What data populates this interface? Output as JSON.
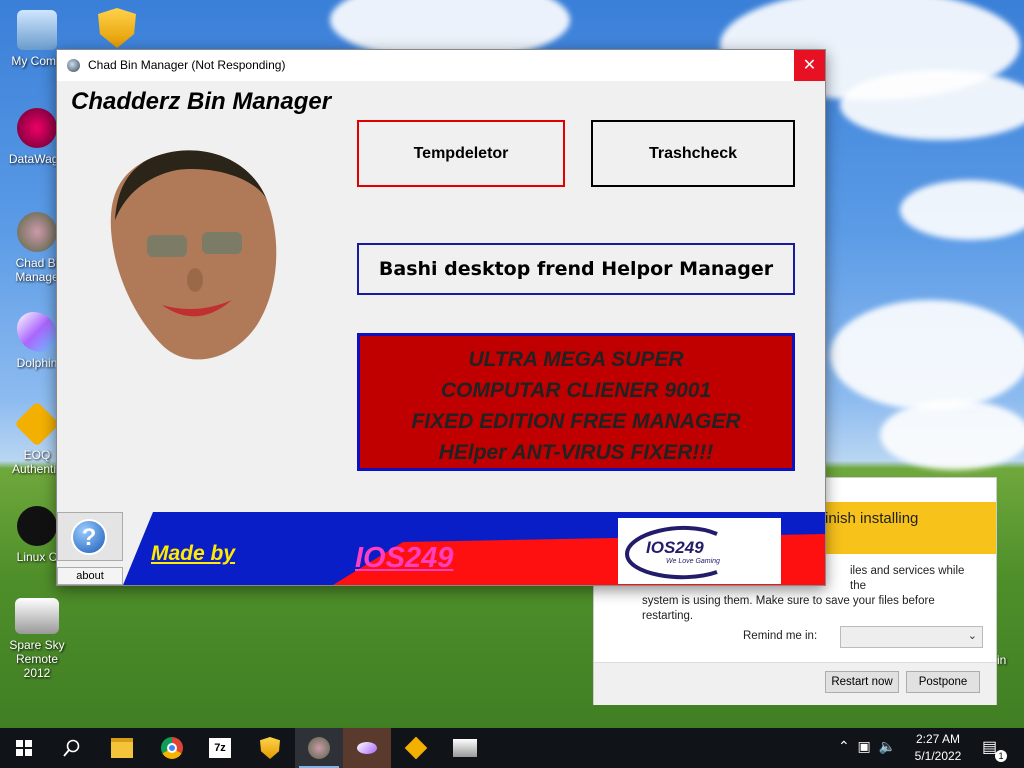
{
  "desktop": {
    "icons": [
      {
        "label": "My Comp"
      },
      {
        "label": "DataWago"
      },
      {
        "label": "Chad Bi\nManage"
      },
      {
        "label": "Dolphin"
      },
      {
        "label": "EOQ\nAuthentic"
      },
      {
        "label": "Linux C"
      },
      {
        "label": "Spare Sky\nRemote 2012"
      }
    ],
    "right_label": "in"
  },
  "window": {
    "title": "Chad Bin Manager (Not Responding)",
    "close_glyph": "✕",
    "heading": "Chadderz Bin Manager",
    "buttons": {
      "tempdeletor": "Tempdeletor",
      "trashcheck": "Trashcheck",
      "bashi": "Bashi desktop frend Helpor Manager",
      "ultra_lines": [
        "ULTRA MEGA SUPER",
        "COMPUTAR CLIENER 9001",
        "FIXED EDITION FREE MANAGER",
        "HElper ANT-VIRUS FIXER!!!"
      ]
    },
    "banner": {
      "made_by": "Made by",
      "author": "IOS249",
      "logo_text": "IOS249",
      "logo_sub": "We Love Gaming"
    },
    "help_glyph": "?",
    "about_label": "about",
    "colors": {
      "accent_red": "#c00000",
      "border_blue": "#1010c0",
      "banner_blue": "#0a1ec8",
      "banner_red": "#ff1010"
    }
  },
  "update_dialog": {
    "title": "inish installing",
    "body_line1": "iles and services while the",
    "body_line2": "system is using them. Make sure to save your files before",
    "body_line3": "restarting.",
    "remind_label": "Remind me in:",
    "remind_value": "",
    "restart_label": "Restart now",
    "postpone_label": "Postpone"
  },
  "taskbar": {
    "items": [
      "windows-start",
      "search",
      "file-explorer",
      "chrome",
      "7zip",
      "security-shield",
      "chad-bin-manager",
      "dolphin",
      "eoq",
      "sky-remote"
    ],
    "clock_time": "2:27 AM",
    "clock_date": "5/1/2022",
    "notification_count": "1"
  }
}
